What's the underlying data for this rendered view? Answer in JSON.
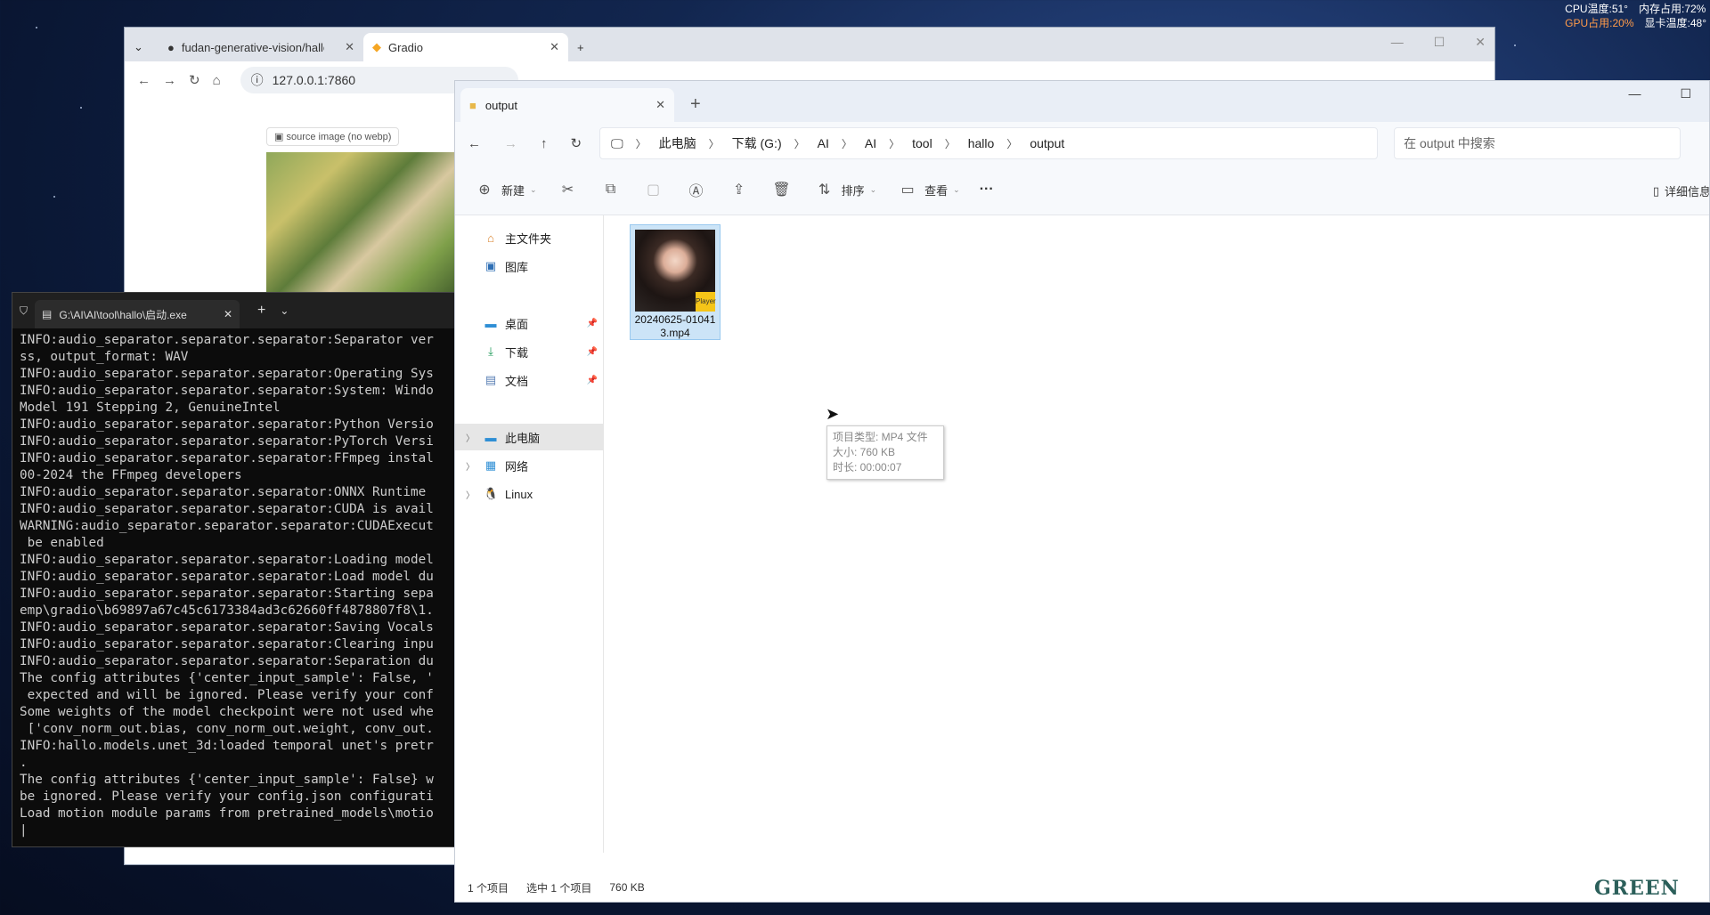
{
  "hw": {
    "cpu": "CPU温度:51°",
    "mem": "内存占用:72%",
    "gpu": "GPU占用:20%",
    "gpu_temp": "显卡温度:48°"
  },
  "browser": {
    "tabs": [
      {
        "label": "fudan-generative-vision/hallo",
        "icon": "github-icon"
      },
      {
        "label": "Gradio",
        "icon": "gradio-icon"
      }
    ],
    "url": "127.0.0.1:7860",
    "source_label": "source image (no webp)"
  },
  "terminal": {
    "tab_title": "G:\\AI\\AI\\tool\\hallo\\启动.exe",
    "lines": [
      "INFO:audio_separator.separator.separator:Separator ver",
      "ss, output_format: WAV",
      "INFO:audio_separator.separator.separator:Operating Sys",
      "INFO:audio_separator.separator.separator:System: Windo",
      "Model 191 Stepping 2, GenuineIntel",
      "INFO:audio_separator.separator.separator:Python Versio",
      "INFO:audio_separator.separator.separator:PyTorch Versi",
      "INFO:audio_separator.separator.separator:FFmpeg instal",
      "00-2024 the FFmpeg developers",
      "INFO:audio_separator.separator.separator:ONNX Runtime",
      "INFO:audio_separator.separator.separator:CUDA is avail",
      "WARNING:audio_separator.separator.separator:CUDAExecut",
      " be enabled",
      "INFO:audio_separator.separator.separator:Loading model",
      "INFO:audio_separator.separator.separator:Load model du",
      "INFO:audio_separator.separator.separator:Starting sepa",
      "emp\\gradio\\b69897a67c45c6173384ad3c62660ff4878807f8\\1.",
      "INFO:audio_separator.separator.separator:Saving Vocals",
      "INFO:audio_separator.separator.separator:Clearing inpu",
      "INFO:audio_separator.separator.separator:Separation du",
      "The config attributes {'center_input_sample': False, '",
      " expected and will be ignored. Please verify your conf",
      "Some weights of the model checkpoint were not used whe",
      " ['conv_norm_out.bias, conv_norm_out.weight, conv_out.",
      "INFO:hallo.models.unet_3d:loaded temporal unet's pretr",
      ".",
      "The config attributes {'center_input_sample': False} w",
      "be ignored. Please verify your config.json configurati",
      "Load motion module params from pretrained_models\\motio",
      "|"
    ]
  },
  "explorer": {
    "tab_title": "output",
    "breadcrumbs": [
      "此电脑",
      "下载 (G:)",
      "AI",
      "AI",
      "tool",
      "hallo",
      "output"
    ],
    "search_placeholder": "在 output 中搜索",
    "toolbar": {
      "new": "新建",
      "sort": "排序",
      "view": "查看",
      "more": "···",
      "details": "详细信息"
    },
    "sidebar": [
      {
        "label": "主文件夹",
        "icon": "home-icon",
        "pin": false
      },
      {
        "label": "图库",
        "icon": "gallery-icon",
        "pin": false
      },
      {
        "label": "桌面",
        "icon": "desktop-icon",
        "pin": true
      },
      {
        "label": "下载",
        "icon": "download-icon",
        "pin": true
      },
      {
        "label": "文档",
        "icon": "document-icon",
        "pin": true
      },
      {
        "label": "此电脑",
        "icon": "computer-icon",
        "pin": false
      },
      {
        "label": "网络",
        "icon": "network-icon",
        "pin": false
      },
      {
        "label": "Linux",
        "icon": "linux-icon",
        "pin": false
      }
    ],
    "file": {
      "name": "20240625-010413.mp4",
      "badge": "Player"
    },
    "tooltip": {
      "type": "项目类型: MP4 文件",
      "size": "大小: 760 KB",
      "duration": "时长: 00:00:07"
    },
    "status": {
      "count": "1 个项目",
      "selected": "选中 1 个项目",
      "size": "760 KB"
    }
  },
  "logo": "GREEN"
}
